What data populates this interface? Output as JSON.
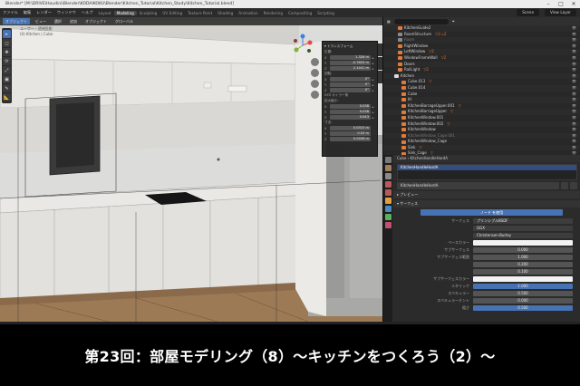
{
  "window": {
    "title": "Blender* [M:\\DRIVE\\Houdini\\Blender\\KODAIKOKU\\Blender\\Kitchen_Tutorial\\Kitchen_Study\\Kitchen_Tutorial.blend]",
    "controls": [
      "–",
      "□",
      "✕"
    ]
  },
  "menubar": {
    "menus": [
      "ファイル",
      "編集",
      "レンダー",
      "ウィンドウ",
      "ヘルプ"
    ],
    "workspaces": [
      "Layout",
      "Modeling",
      "Sculpting",
      "UV Editing",
      "Texture Paint",
      "Shading",
      "Animation",
      "Rendering",
      "Compositing",
      "Scripting"
    ],
    "active_workspace": "Modeling",
    "scene": "Scene",
    "view_layer": "View Layer"
  },
  "viewport": {
    "header_buttons": [
      "オブジェクト",
      "ビュー",
      "選択",
      "追加",
      "オブジェクト",
      "グローバル"
    ],
    "info_line1": "ユーザー・透視投影",
    "info_line2": "(0) Kitchen | Cube",
    "tools": [
      "▸",
      "◻",
      "✥",
      "⟳",
      "⤢",
      "▣",
      "✎",
      "📐"
    ]
  },
  "npanel": {
    "section_transform": "▾ トランスフォーム",
    "location_label": "位置:",
    "location": [
      {
        "axis": "X",
        "value": "1.326 m"
      },
      {
        "axis": "Y",
        "value": "-0.7803 m"
      },
      {
        "axis": "Z",
        "value": "2.1441 m"
      }
    ],
    "rotation_label": "回転:",
    "rotation": [
      {
        "axis": "X",
        "value": "0°"
      },
      {
        "axis": "Y",
        "value": "0°"
      },
      {
        "axis": "Z",
        "value": "0°"
      }
    ],
    "mode_label": "XYZ オイラー角",
    "scale_label": "拡大縮小:",
    "scale": [
      {
        "axis": "X",
        "value": "0.038"
      },
      {
        "axis": "Y",
        "value": "0.038"
      },
      {
        "axis": "Z",
        "value": "0.043"
      }
    ],
    "dimensions_label": "寸法:",
    "dimensions": [
      {
        "axis": "X",
        "value": "0.0315 m"
      },
      {
        "axis": "Y",
        "value": "0.03 m"
      },
      {
        "axis": "Z",
        "value": "0.0458 m"
      }
    ]
  },
  "outliner": {
    "rows": [
      {
        "name": "KitchenGuide2",
        "color": "#e07b39",
        "badge": "",
        "dim": false
      },
      {
        "name": "RoomStructure",
        "color": "#8a8a8a",
        "badge": "▽3 ◇2",
        "dim": false
      },
      {
        "name": "Room",
        "color": "#8a8a8a",
        "badge": "",
        "dim": true
      },
      {
        "name": "RightWindow",
        "color": "#e07b39",
        "badge": "",
        "dim": false
      },
      {
        "name": "LeftWindow",
        "color": "#e07b39",
        "badge": "▽2",
        "dim": false
      },
      {
        "name": "WindowFrameWall",
        "color": "#e07b39",
        "badge": "▽2",
        "dim": false
      },
      {
        "name": "Doors",
        "color": "#e07b39",
        "badge": "",
        "dim": false
      },
      {
        "name": "RailLight",
        "color": "#e07b39",
        "badge": "▽2",
        "dim": false
      },
      {
        "name": "Kitchen",
        "color": "#dcdcdc",
        "badge": "",
        "dim": false
      },
      {
        "name": "Cube.013",
        "color": "#e07b39",
        "badge": "▽",
        "dim": false
      },
      {
        "name": "Cube.014",
        "color": "#e07b39",
        "badge": "",
        "dim": false
      },
      {
        "name": "Cube",
        "color": "#e07b39",
        "badge": "",
        "dim": false
      },
      {
        "name": "IH",
        "color": "#e07b39",
        "badge": "",
        "dim": false
      },
      {
        "name": "KitchenBarrageUpper.001",
        "color": "#e07b39",
        "badge": "▽",
        "dim": false
      },
      {
        "name": "KitchenBarrageUpper",
        "color": "#e07b39",
        "badge": "▽",
        "dim": false
      },
      {
        "name": "KitchenWindow.001",
        "color": "#e07b39",
        "badge": "",
        "dim": false
      },
      {
        "name": "KitchenWindow.002",
        "color": "#e07b39",
        "badge": "▽",
        "dim": false
      },
      {
        "name": "KitchenWindow",
        "color": "#e07b39",
        "badge": "",
        "dim": false
      },
      {
        "name": "KitchenWindow_Cage.001",
        "color": "#e07b39",
        "badge": "",
        "dim": true
      },
      {
        "name": "KitchenWindow_Cage",
        "color": "#e07b39",
        "badge": "",
        "dim": false
      },
      {
        "name": "Sink",
        "color": "#e07b39",
        "badge": "▽",
        "dim": false
      },
      {
        "name": "Sink_Cage",
        "color": "#e07b39",
        "badge": "▽",
        "dim": false
      }
    ]
  },
  "properties": {
    "path_object": "Cube",
    "path_material": "KitchenHandleHardA",
    "slot_name": "KitchenHandleHardA",
    "material_field": "KitchenHandleHardA",
    "section_preview": "▸ プレビュー",
    "section_surface": "▾ サーフェス",
    "node_name": "ノード を使用",
    "rows": [
      {
        "key": "サーフェス",
        "value": "プリンシプルBSDF",
        "style": "dark"
      },
      {
        "key": "",
        "value": "GGX",
        "style": "dark"
      },
      {
        "key": "",
        "value": "Christensen-Burley",
        "style": "dark"
      },
      {
        "key": "ベースカラー",
        "value": "",
        "style": "white"
      },
      {
        "key": "サブサーフェス",
        "value": "0.000",
        "style": ""
      },
      {
        "key": "サブサーフェス範囲",
        "value": "1.000",
        "style": ""
      },
      {
        "key": "",
        "value": "0.200",
        "style": ""
      },
      {
        "key": "",
        "value": "0.100",
        "style": ""
      },
      {
        "key": "サブサーフェスカラー",
        "value": "",
        "style": "white"
      },
      {
        "key": "メタリック",
        "value": "1.000",
        "style": "blue"
      },
      {
        "key": "スペキュラー",
        "value": "0.500",
        "style": ""
      },
      {
        "key": "スペキュラーチント",
        "value": "0.000",
        "style": ""
      },
      {
        "key": "粗さ",
        "value": "0.500",
        "style": "blue"
      }
    ]
  },
  "caption": {
    "text": "第23回：部屋モデリング（8）〜キッチンをつくろう（2）〜"
  }
}
